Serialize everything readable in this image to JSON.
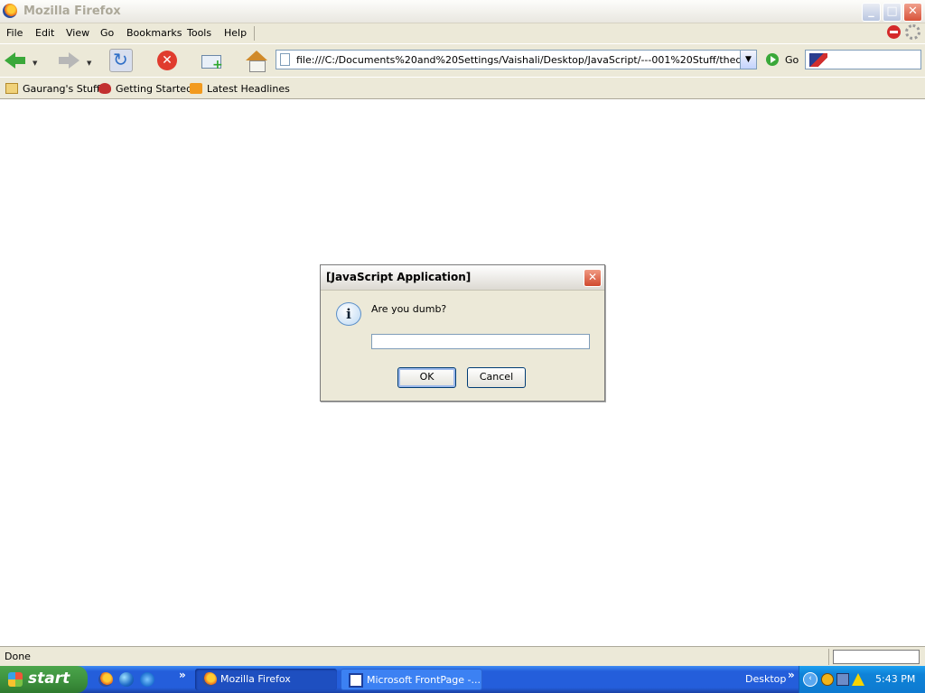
{
  "window": {
    "title": "Mozilla Firefox"
  },
  "menu": {
    "items": [
      "File",
      "Edit",
      "View",
      "Go",
      "Bookmarks",
      "Tools",
      "Help"
    ]
  },
  "nav": {
    "url": "file:///C:/Documents%20and%20Settings/Vaishali/Desktop/JavaScript/---001%20Stuff/thedumbtest.;",
    "go_label": "Go",
    "search_value": ""
  },
  "bookmarks": [
    {
      "label": "Gaurang's Stuff",
      "icon": "folder-icon"
    },
    {
      "label": "Getting Started",
      "icon": "bookmark-star-icon"
    },
    {
      "label": "Latest Headlines",
      "icon": "rss-icon"
    }
  ],
  "dialog": {
    "title": "[JavaScript Application]",
    "message": "Are you dumb?",
    "input_value": "",
    "ok_label": "OK",
    "cancel_label": "Cancel",
    "icon": "info-icon"
  },
  "status": {
    "text": "Done"
  },
  "taskbar": {
    "start_label": "start",
    "tasks": [
      {
        "label": "Mozilla Firefox"
      },
      {
        "label": "Microsoft FrontPage -..."
      }
    ],
    "desktop_label": "Desktop",
    "clock": "5:43 PM"
  }
}
